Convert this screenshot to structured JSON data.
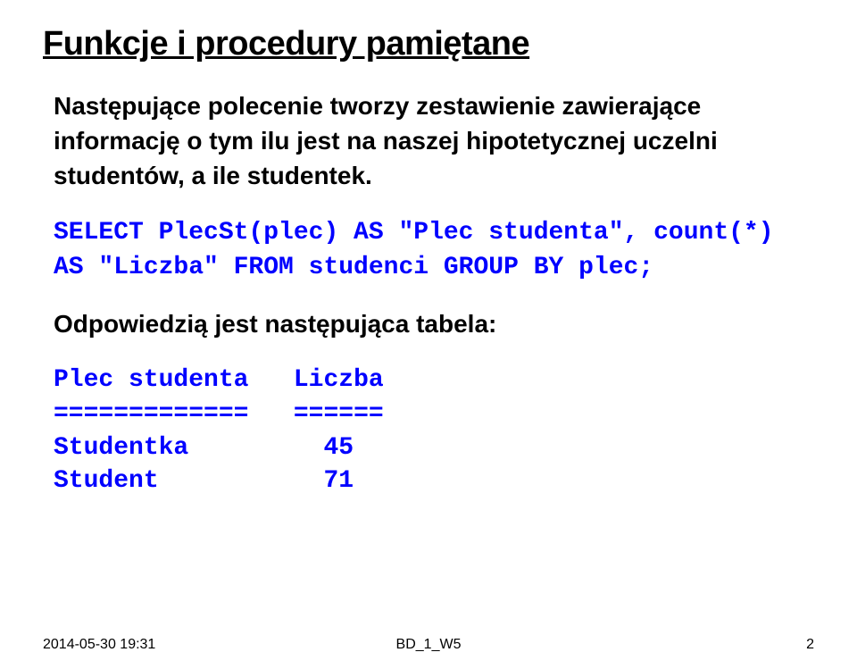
{
  "title": "Funkcje i procedury pamiętane",
  "intro": "Następujące polecenie tworzy zestawienie zawierające informację o tym ilu jest na naszej hipotetycznej uczelni studentów, a ile studentek.",
  "code": "SELECT PlecSt(plec) AS \"Plec studenta\", count(*) AS \"Liczba\" FROM studenci GROUP BY plec;",
  "response_label": "Odpowiedzią jest następująca  tabela:",
  "result": {
    "header_col1": "Plec studenta",
    "header_col2": "Liczba",
    "sep_col1": "=============",
    "sep_col2": "======",
    "rows": [
      {
        "c1": "Studentka",
        "c2": "45"
      },
      {
        "c1": "Student",
        "c2": "71"
      }
    ]
  },
  "footer": {
    "left": "2014-05-30 19:31",
    "center": "BD_1_W5",
    "right": "2"
  }
}
